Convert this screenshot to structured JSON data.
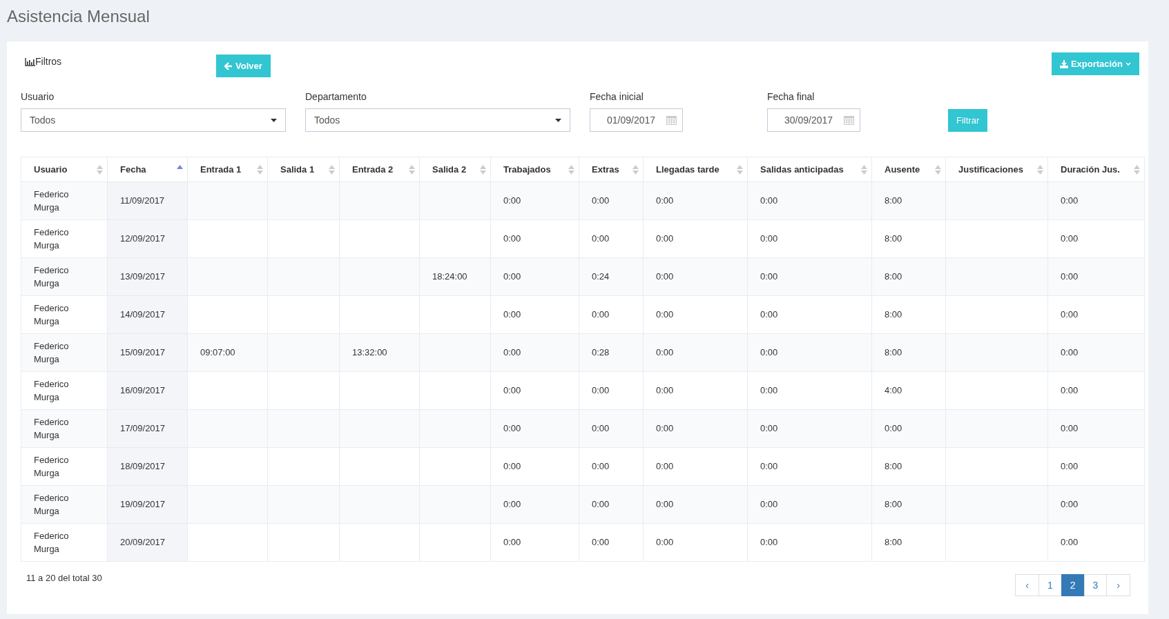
{
  "page_title": "Asistencia Mensual",
  "filters_label": "Filtros",
  "back_button": "Volver",
  "export_button": "Exportación",
  "filters": [
    {
      "kind": "select",
      "label": "Usuario",
      "value": "Todos"
    },
    {
      "kind": "select",
      "label": "Departamento",
      "value": "Todos"
    },
    {
      "kind": "date",
      "label": "Fecha inicial",
      "value": "01/09/2017"
    },
    {
      "kind": "date",
      "label": "Fecha final",
      "value": "30/09/2017"
    }
  ],
  "filter_button": "Filtrar",
  "table": {
    "columns": [
      {
        "label": "Usuario",
        "sorted": false
      },
      {
        "label": "Fecha",
        "sorted": true
      },
      {
        "label": "Entrada 1",
        "sorted": false
      },
      {
        "label": "Salida 1",
        "sorted": false
      },
      {
        "label": "Entrada 2",
        "sorted": false
      },
      {
        "label": "Salida 2",
        "sorted": false
      },
      {
        "label": "Trabajados",
        "sorted": false
      },
      {
        "label": "Extras",
        "sorted": false
      },
      {
        "label": "Llegadas tarde",
        "sorted": false
      },
      {
        "label": "Salidas anticipadas",
        "sorted": false
      },
      {
        "label": "Ausente",
        "sorted": false
      },
      {
        "label": "Justificaciones",
        "sorted": false
      },
      {
        "label": "Duración Jus.",
        "sorted": false
      }
    ],
    "rows": [
      [
        "Federico Murga",
        "11/09/2017",
        "",
        "",
        "",
        "",
        "0:00",
        "0:00",
        "0:00",
        "0:00",
        "8:00",
        "",
        "0:00"
      ],
      [
        "Federico Murga",
        "12/09/2017",
        "",
        "",
        "",
        "",
        "0:00",
        "0:00",
        "0:00",
        "0:00",
        "8:00",
        "",
        "0:00"
      ],
      [
        "Federico Murga",
        "13/09/2017",
        "",
        "",
        "",
        "18:24:00",
        "0:00",
        "0:24",
        "0:00",
        "0:00",
        "8:00",
        "",
        "0:00"
      ],
      [
        "Federico Murga",
        "14/09/2017",
        "",
        "",
        "",
        "",
        "0:00",
        "0:00",
        "0:00",
        "0:00",
        "8:00",
        "",
        "0:00"
      ],
      [
        "Federico Murga",
        "15/09/2017",
        "09:07:00",
        "",
        "13:32:00",
        "",
        "0:00",
        "0:28",
        "0:00",
        "0:00",
        "8:00",
        "",
        "0:00"
      ],
      [
        "Federico Murga",
        "16/09/2017",
        "",
        "",
        "",
        "",
        "0:00",
        "0:00",
        "0:00",
        "0:00",
        "4:00",
        "",
        "0:00"
      ],
      [
        "Federico Murga",
        "17/09/2017",
        "",
        "",
        "",
        "",
        "0:00",
        "0:00",
        "0:00",
        "0:00",
        "0:00",
        "",
        "0:00"
      ],
      [
        "Federico Murga",
        "18/09/2017",
        "",
        "",
        "",
        "",
        "0:00",
        "0:00",
        "0:00",
        "0:00",
        "8:00",
        "",
        "0:00"
      ],
      [
        "Federico Murga",
        "19/09/2017",
        "",
        "",
        "",
        "",
        "0:00",
        "0:00",
        "0:00",
        "0:00",
        "8:00",
        "",
        "0:00"
      ],
      [
        "Federico Murga",
        "20/09/2017",
        "",
        "",
        "",
        "",
        "0:00",
        "0:00",
        "0:00",
        "0:00",
        "8:00",
        "",
        "0:00"
      ]
    ]
  },
  "table_info": "11 a 20 del total 30",
  "pagination": [
    {
      "label": "‹",
      "kind": "prev",
      "selected": false
    },
    {
      "label": "1",
      "kind": "page",
      "selected": false
    },
    {
      "label": "2",
      "kind": "page",
      "selected": true
    },
    {
      "label": "3",
      "kind": "page",
      "selected": false
    },
    {
      "label": "›",
      "kind": "next",
      "selected": false
    }
  ]
}
